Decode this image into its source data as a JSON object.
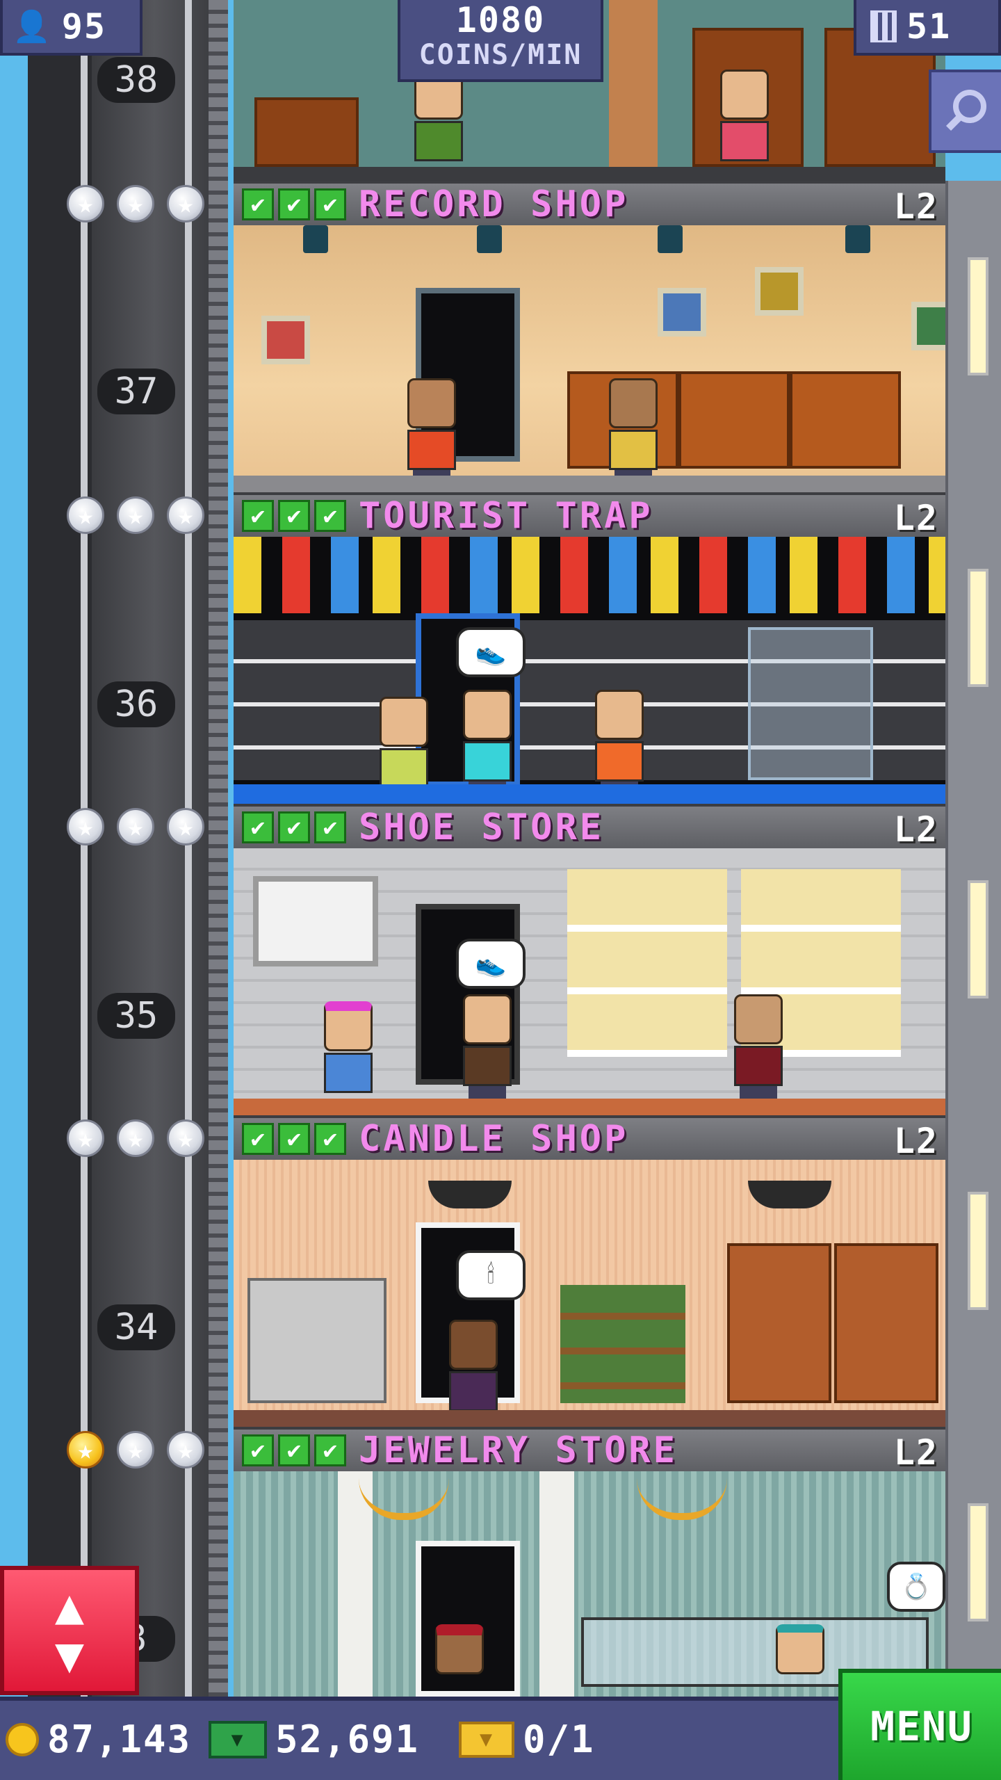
{
  "hud": {
    "population": "95",
    "coins_per_min_value": "1080",
    "coins_per_min_label": "COINS/MIN",
    "floors": "51",
    "population_icon": "person-icon",
    "floors_icon": "building-icon",
    "search_icon": "magnifier-icon"
  },
  "elevator": {
    "floor_numbers": [
      "38",
      "37",
      "36",
      "35",
      "34",
      "3"
    ]
  },
  "floors": [
    {
      "name": "RECORD SHOP",
      "level": "L2",
      "checks": 3,
      "stars_gold": 0
    },
    {
      "name": "TOURIST TRAP",
      "level": "L2",
      "checks": 3,
      "stars_gold": 0
    },
    {
      "name": "SHOE STORE",
      "level": "L2",
      "checks": 3,
      "stars_gold": 0
    },
    {
      "name": "CANDLE SHOP",
      "level": "L2",
      "checks": 3,
      "stars_gold": 0
    },
    {
      "name": "JEWELRY STORE",
      "level": "L2",
      "checks": 3,
      "stars_gold": 1
    }
  ],
  "bottom": {
    "coins": "87,143",
    "bux": "52,691",
    "tickets": "0/1",
    "menu_label": "MENU"
  },
  "colors": {
    "hud_bg": "#4a4f82",
    "floor_name": "#f28aec",
    "menu_green": "#1ea62d",
    "elevator_button_red": "#e11838"
  }
}
